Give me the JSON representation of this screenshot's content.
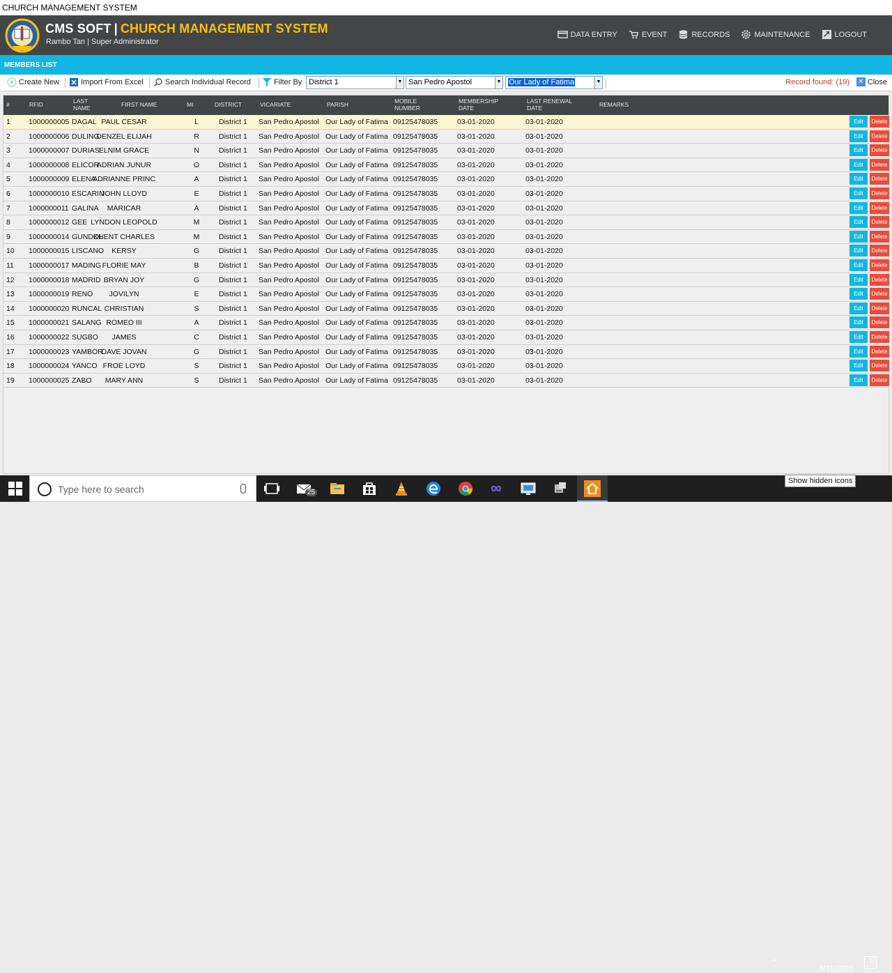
{
  "window_title": "CHURCH MANAGEMENT SYSTEM",
  "header": {
    "brand_left": "CMS SOFT",
    "brand_sep": "|",
    "brand_right": "CHURCH MANAGEMENT SYSTEM",
    "user": "Rambo Tan | Super Administrator",
    "nav": [
      {
        "label": "DATA ENTRY",
        "icon": "data-entry-icon"
      },
      {
        "label": "EVENT",
        "icon": "cart-icon"
      },
      {
        "label": "RECORDS",
        "icon": "database-icon"
      },
      {
        "label": "MAINTENANCE",
        "icon": "gear-icon"
      },
      {
        "label": "LOGOUT",
        "icon": "logout-icon"
      }
    ]
  },
  "section_title": "MEMBERS LIST",
  "toolbar": {
    "create_new": "Create New",
    "import_excel": "Import From Excel",
    "search_individual": "Search Individual Record",
    "filter_by": "Filter By",
    "filter_district": "District 1",
    "filter_vicariate": "San Pedro Apostol",
    "filter_parish": "Our Lady of Fatima",
    "record_found": "Record found: (19)",
    "close": "Close"
  },
  "table": {
    "columns": [
      "#",
      "RFID",
      "LAST NAME",
      "FIRST NAME",
      "MI",
      "DISTRICT",
      "VICARIATE",
      "PARISH",
      "MOBILE NUMBER",
      "MEMBERSHIP DATE",
      "LAST RENEWAL DATE",
      "REMARKS"
    ],
    "edit_label": "Edit",
    "delete_label": "Delete",
    "rows": [
      [
        "1",
        "1000000005",
        "DAGAL",
        "PAUL CESAR",
        "L",
        "District 1",
        "San Pedro Apostol",
        "Our Lady of Fatima",
        "09125478035",
        "03-01-2020",
        "03-01-2020",
        ""
      ],
      [
        "2",
        "1000000006",
        "DULING",
        "DENZEL ELIJAH",
        "R",
        "District 1",
        "San Pedro Apostol",
        "Our Lady of Fatima",
        "09125478035",
        "03-01-2020",
        "03-01-2020",
        ""
      ],
      [
        "3",
        "1000000007",
        "DURIAS",
        "ELNIM GRACE",
        "N",
        "District 1",
        "San Pedro Apostol",
        "Our Lady of Fatima",
        "09125478035",
        "03-01-2020",
        "03-01-2020",
        ""
      ],
      [
        "4",
        "1000000008",
        "ELICOR",
        "ADRIAN JUNUR",
        "O",
        "District 1",
        "San Pedro Apostol",
        "Our Lady of Fatima",
        "09125478035",
        "03-01-2020",
        "03-01-2020",
        ""
      ],
      [
        "5",
        "1000000009",
        "ELENA",
        "ADRIANNE PRINC",
        "A",
        "District 1",
        "San Pedro Apostol",
        "Our Lady of Fatima",
        "09125478035",
        "03-01-2020",
        "03-01-2020",
        ""
      ],
      [
        "6",
        "1000000010",
        "ESCARIN",
        "JOHN LLOYD",
        "E",
        "District 1",
        "San Pedro Apostol",
        "Our Lady of Fatima",
        "09125478035",
        "03-01-2020",
        "03-01-2020",
        ""
      ],
      [
        "7",
        "1000000011",
        "GALINA",
        "MARICAR",
        "A",
        "District 1",
        "San Pedro Apostol",
        "Our Lady of Fatima",
        "09125478035",
        "03-01-2020",
        "03-01-2020",
        ""
      ],
      [
        "8",
        "1000000012",
        "GEE",
        "LYNDON LEOPOLD",
        "M",
        "District 1",
        "San Pedro Apostol",
        "Our Lady of Fatima",
        "09125478035",
        "03-01-2020",
        "03-01-2020",
        ""
      ],
      [
        "9",
        "1000000014",
        "GUNDOL",
        "KHENT CHARLES",
        "M",
        "District 1",
        "San Pedro Apostol",
        "Our Lady of Fatima",
        "09125478035",
        "03-01-2020",
        "03-01-2020",
        ""
      ],
      [
        "10",
        "1000000015",
        "LISCANO",
        "KERSY",
        "G",
        "District 1",
        "San Pedro Apostol",
        "Our Lady of Fatima",
        "09125478035",
        "03-01-2020",
        "03-01-2020",
        ""
      ],
      [
        "11",
        "1000000017",
        "MADING",
        "FLORIE MAY",
        "B",
        "District 1",
        "San Pedro Apostol",
        "Our Lady of Fatima",
        "09125478035",
        "03-01-2020",
        "03-01-2020",
        ""
      ],
      [
        "12",
        "1000000018",
        "MADRID",
        "BRYAN JOY",
        "G",
        "District 1",
        "San Pedro Apostol",
        "Our Lady of Fatima",
        "09125478035",
        "03-01-2020",
        "03-01-2020",
        ""
      ],
      [
        "13",
        "1000000019",
        "RENO",
        "JOVILYN",
        "E",
        "District 1",
        "San Pedro Apostol",
        "Our Lady of Fatima",
        "09125478035",
        "03-01-2020",
        "03-01-2020",
        ""
      ],
      [
        "14",
        "1000000020",
        "RUNCAL",
        "CHRISTIAN",
        "S",
        "District 1",
        "San Pedro Apostol",
        "Our Lady of Fatima",
        "09125478035",
        "03-01-2020",
        "03-01-2020",
        ""
      ],
      [
        "15",
        "1000000021",
        "SALANG",
        "ROMEO III",
        "A",
        "District 1",
        "San Pedro Apostol",
        "Our Lady of Fatima",
        "09125478035",
        "03-01-2020",
        "03-01-2020",
        ""
      ],
      [
        "16",
        "1000000022",
        "SUGBO",
        "JAMES",
        "C",
        "District 1",
        "San Pedro Apostol",
        "Our Lady of Fatima",
        "09125478035",
        "03-01-2020",
        "03-01-2020",
        ""
      ],
      [
        "17",
        "1000000023",
        "YAMBOR",
        "DAVE JOVAN",
        "G",
        "District 1",
        "San Pedro Apostol",
        "Our Lady of Fatima",
        "09125478035",
        "03-01-2020",
        "03-01-2020",
        ""
      ],
      [
        "18",
        "1000000024",
        "YANCO",
        "FROE LOYD",
        "S",
        "District 1",
        "San Pedro Apostol",
        "Our Lady of Fatima",
        "09125478035",
        "03-01-2020",
        "03-01-2020",
        ""
      ],
      [
        "19",
        "1000000025",
        "ZABO",
        "MARY ANN",
        "S",
        "District 1",
        "San Pedro Apostol",
        "Our Lady of Fatima",
        "09125478035",
        "03-01-2020",
        "03-01-2020",
        ""
      ]
    ]
  },
  "taskbar": {
    "search_placeholder": "Type here to search",
    "mail_badge": "25",
    "tooltip": "Show hidden icons",
    "clock": "3/31/2020",
    "notification_count": "11"
  },
  "colors": {
    "header_bg": "#444546",
    "accent": "#12b6e2",
    "brand_yellow": "#f4c20d",
    "delete_red": "#e74c3c",
    "selected_row": "#fdf6d3"
  }
}
